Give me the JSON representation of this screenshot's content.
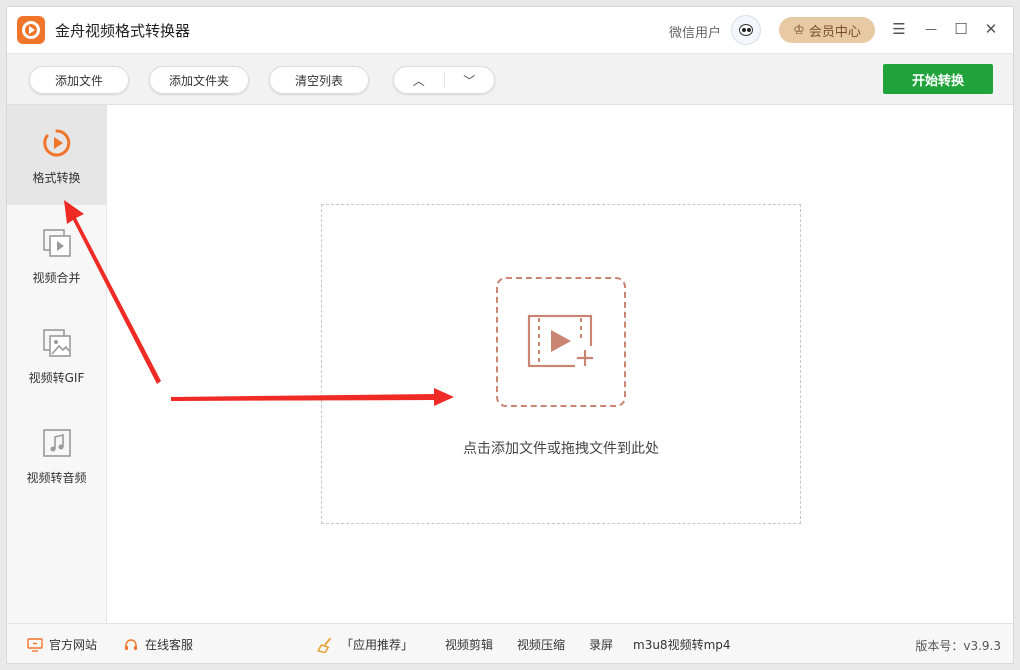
{
  "app": {
    "title": "金舟视频格式转换器",
    "user_name": "微信用户",
    "vip_label": "会员中心"
  },
  "window_controls": {
    "menu": "☰",
    "minimize": "—",
    "maximize": "☐",
    "close": "✕"
  },
  "toolbar": {
    "add_file": "添加文件",
    "add_folder": "添加文件夹",
    "clear_list": "清空列表",
    "move_up": "︿",
    "move_down": "﹀",
    "start": "开始转换"
  },
  "sidebar": {
    "items": [
      {
        "label": "格式转换",
        "icon": "play-circle-icon",
        "active": true
      },
      {
        "label": "视频合并",
        "icon": "video-merge-icon",
        "active": false
      },
      {
        "label": "视频转GIF",
        "icon": "image-icon",
        "active": false
      },
      {
        "label": "视频转音频",
        "icon": "music-note-icon",
        "active": false
      }
    ]
  },
  "main": {
    "drop_hint": "点击添加文件或拖拽文件到此处"
  },
  "footer": {
    "website": "官方网站",
    "support": "在线客服",
    "recommend": "「应用推荐」",
    "links": [
      "视频剪辑",
      "视频压缩",
      "录屏",
      "m3u8视频转mp4"
    ],
    "version": "版本号：v3.9.3"
  },
  "colors": {
    "accent_orange": "#f0752a",
    "start_green": "#21a33c",
    "vip_bg": "#e7c9a3",
    "drop_icon": "#c98572",
    "annotation_red": "#f02b25"
  }
}
